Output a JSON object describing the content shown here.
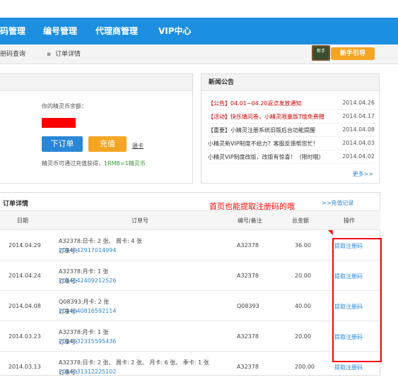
{
  "nav": {
    "items": [
      {
        "label": "码管理"
      },
      {
        "label": "编号管理"
      },
      {
        "label": "代理商管理"
      },
      {
        "label": "VIP中心"
      }
    ]
  },
  "breadcrumb": {
    "items": [
      {
        "label": "册码查询"
      },
      {
        "label": "订单详情"
      }
    ]
  },
  "guide": {
    "board_text": "新手",
    "button_label": "新手引导"
  },
  "account": {
    "balance_label": "你的精灵币余额：",
    "order_button": "下订单",
    "charge_button": "充值",
    "refund_link": "退卡",
    "hint_prefix": "精灵币可通过充值获得，",
    "hint_rate": "1RMB=1精灵币"
  },
  "news": {
    "title": "新闻公告",
    "items": [
      {
        "text": "【公告】04.01~04.20返点发放通知",
        "date": "2014.04.26",
        "color": "#cc0000"
      },
      {
        "text": "【活动】快乐填问卷，小精灵限量版T恤免费赠",
        "date": "2014.04.17",
        "color": "#cc0000"
      },
      {
        "text": "【重要】小精灵注册系统旧版后台功能提醒",
        "date": "2014.04.08",
        "color": "#333333"
      },
      {
        "text": "小精灵新VIP制度不给力？客服反馈帮您忙！",
        "date": "2014.04.03",
        "color": "#333333"
      },
      {
        "text": "小精灵VIP制度改版，改版有惊喜！（限时哦）",
        "date": "2014.04.02",
        "color": "#333333"
      }
    ],
    "more": "更多>>"
  },
  "orders": {
    "title": "订单详情",
    "recharge_link": ">>充值记录",
    "annotation": "首页也能提取注册码的哦",
    "headers": {
      "date": "日期",
      "order_no": "订单号",
      "code": "编号/备注",
      "amount": "总金额",
      "action": "操作"
    },
    "rows": [
      {
        "date": "2014.04.29",
        "detail": "A32378:日卡: 2 张、 周卡: 4 张",
        "order_prefix": "订单号: ",
        "order_no": "2014042917014994",
        "code": "A32378",
        "amount": "36.00",
        "action": "提取注册码"
      },
      {
        "date": "2014.04.24",
        "detail": "A32378:月卡: 1 张",
        "order_prefix": "订单号: ",
        "order_no": "2014042409212526",
        "code": "A32378",
        "amount": "20.00",
        "action": "提取注册码"
      },
      {
        "date": "2014.04.08",
        "detail": "Q08393:月卡: 2 张",
        "order_prefix": "订单号: ",
        "order_no": "2014040816592114",
        "code": "Q08393",
        "amount": "40.00",
        "action": "提取注册码"
      },
      {
        "date": "2014.03.23",
        "detail": "A32378:月卡: 1 张",
        "order_prefix": "订单号: ",
        "order_no": "2014032315595436",
        "code": "A32378",
        "amount": "20.00",
        "action": "提取注册码"
      },
      {
        "date": "2014.03.13",
        "detail": "A32378:日卡: 2 张、 周卡: 2 张、 月卡: 6 张、 季卡: 1 张",
        "order_prefix": "订单号: ",
        "order_no": "2014031312225102",
        "code": "A32378",
        "amount": "200.00",
        "action": "提取注册码"
      }
    ]
  },
  "colors": {
    "nav": "#1d8fe0",
    "accent_orange": "#f5a524",
    "link_blue": "#2a86d6",
    "annotation_red": "#ff0000"
  }
}
